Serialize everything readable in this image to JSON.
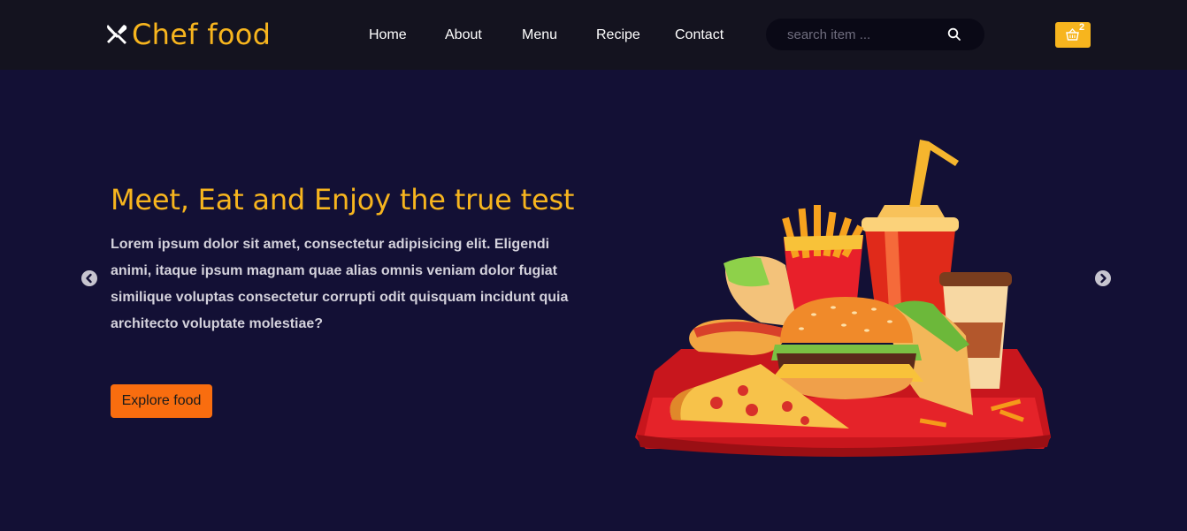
{
  "brand": {
    "name": "Chef food",
    "icon": "fork-knife-icon",
    "color": "#f7b51e"
  },
  "nav": {
    "items": [
      {
        "label": "Home"
      },
      {
        "label": "About"
      },
      {
        "label": "Menu"
      },
      {
        "label": "Recipe"
      },
      {
        "label": "Contact"
      }
    ]
  },
  "search": {
    "placeholder": "search item ...",
    "value": "",
    "icon": "search-icon"
  },
  "cart": {
    "icon": "basket-icon",
    "count": "2"
  },
  "hero": {
    "title": "Meet, Eat and Enjoy the true test",
    "description": "Lorem ipsum dolor sit amet, consectetur adipisicing elit. Eligendi animi, itaque ipsum magnam quae alias omnis veniam dolor fugiat similique voluptas consectetur corrupti odit quisquam incidunt quia architecto voluptate molestiae?",
    "button_label": "Explore food",
    "image": "fast-food-tray-illustration"
  },
  "carousel": {
    "prev_icon": "chevron-left-icon",
    "next_icon": "chevron-right-icon"
  },
  "colors": {
    "background": "#131035",
    "navbar": "#14131f",
    "accent": "#f7b51e",
    "button": "#f96d0f"
  }
}
